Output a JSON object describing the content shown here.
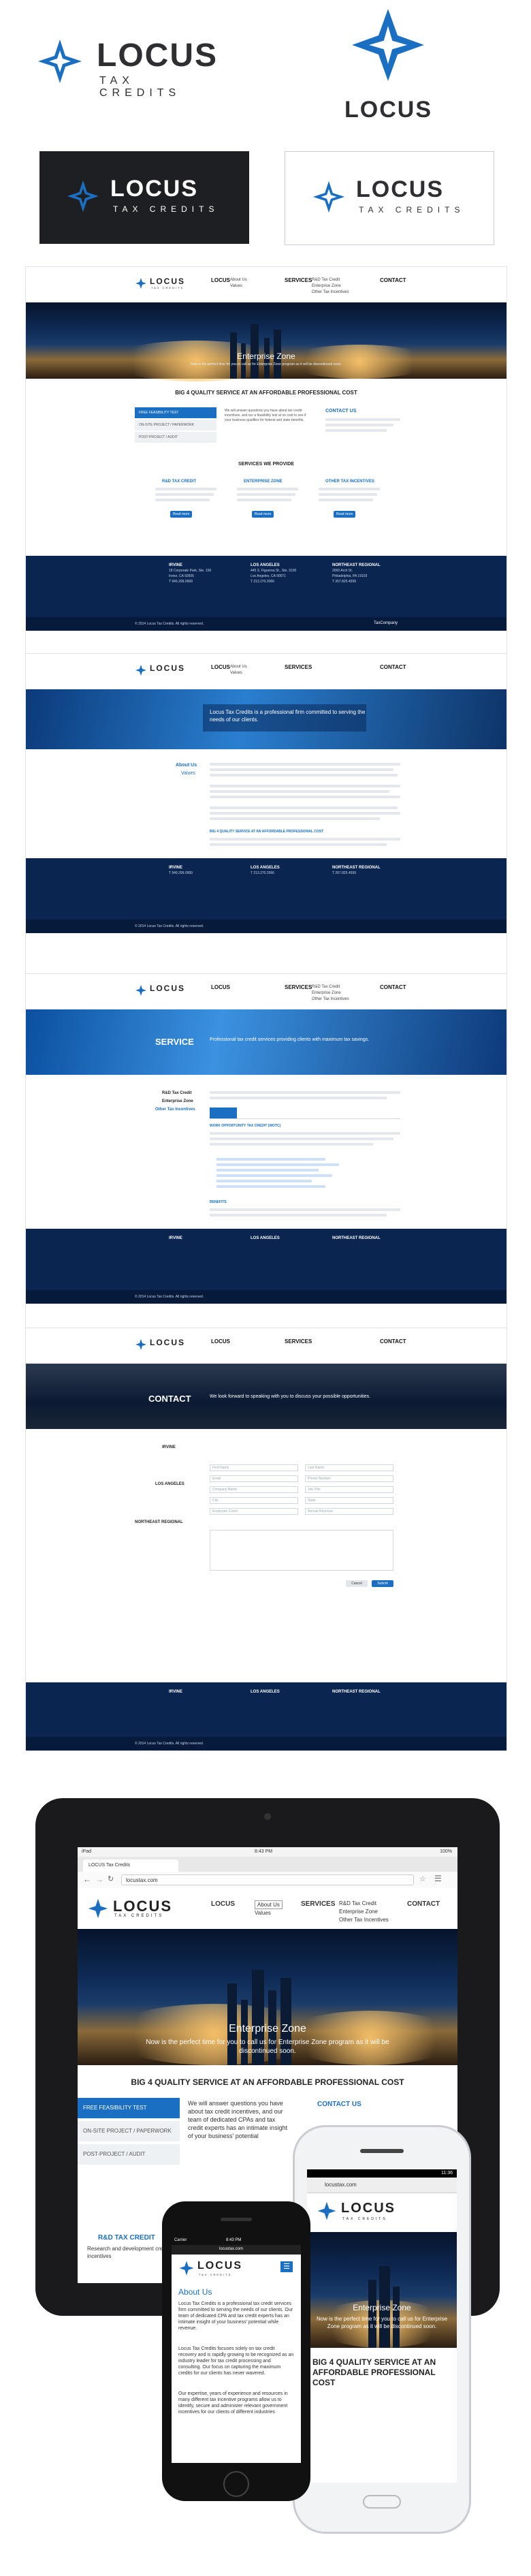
{
  "brand": {
    "name": "LOCUS",
    "tagline": "TAX CREDITS",
    "colors": {
      "primary_blue": "#1b6fc2",
      "navy": "#0b2a55",
      "dark_box": "#1e1f22"
    }
  },
  "nav": {
    "items": [
      "LOCUS",
      "About Us",
      "Values",
      "SERVICES",
      "R&D Tax Credit",
      "Enterprise Zone",
      "Other Tax Incentives",
      "CONTACT"
    ]
  },
  "home": {
    "hero_title": "Enterprise Zone",
    "hero_sub": "Now is the perfect time for you to call us for Enterprise Zone program as it will be discontinued soon.",
    "tagline": "BIG 4 QUALITY SERVICE AT AN AFFORDABLE PROFESSIONAL COST",
    "tabs": [
      "FREE FEASIBILITY TEST",
      "ON-SITE PROJECT / PAPERWORK",
      "POST-PROJECT / AUDIT"
    ],
    "answer_text": "We will answer questions you have about tax credit incentives, and run a feasibility test at no cost to see if your business qualifies for federal and state benefits.",
    "contact_us": "CONTACT US",
    "services_heading": "SERVICES WE PROVIDE",
    "services": [
      "R&D TAX CREDIT",
      "ENTERPRISE ZONE",
      "OTHER TAX INCENTIVES"
    ],
    "read_more": "Read more"
  },
  "footer": {
    "cols": [
      {
        "title": "IRVINE",
        "lines": [
          "18 Corporate Park, Ste. 150",
          "Irvine, CA 92606",
          "T 949.299.0999"
        ]
      },
      {
        "title": "LOS ANGELES",
        "lines": [
          "445 S. Figueroa St., Ste. 3100",
          "Los Angeles, CA 90071",
          "T 213.270.2066"
        ]
      },
      {
        "title": "NORTHEAST REGIONAL",
        "lines": [
          "2000 Arch St.",
          "Philadelphia, PA 19103",
          "T 267.825.4599"
        ]
      }
    ],
    "copyright": "© 2014 Locus Tax Credits. All rights reserved.",
    "partner": "TaxCompany"
  },
  "about": {
    "hero": "Locus Tax Credits is a professional firm committed to serving the needs of our clients.",
    "side": [
      "About Us",
      "Values"
    ],
    "heading": "BIG 4 QUALITY SERVICE AT AN AFFORDABLE PROFESSIONAL COST"
  },
  "service": {
    "hero_title": "SERVICE",
    "hero_sub": "Professional tax credit services providing clients with maximum tax savings.",
    "side": [
      "R&D Tax Credit",
      "Enterprise Zone",
      "Other Tax Incentives"
    ],
    "section_heading": "WORK OPPORTUNITY TAX CREDIT (WOTC)",
    "benefits": "BENEFITS"
  },
  "contact": {
    "hero_title": "CONTACT",
    "hero_sub": "We look forward to speaking with you to discuss your possible opportunities.",
    "form": [
      "First Name",
      "Last Name",
      "Email",
      "Phone Number",
      "Company Name",
      "Job Title",
      "City",
      "State",
      "Employee Count",
      "Annual Revenue"
    ],
    "cancel": "Cancel",
    "submit": "Submit"
  },
  "devices": {
    "tablet": {
      "status_left": "iPad",
      "time": "8:43 PM",
      "battery": "100%",
      "tab_title": "LOCUS Tax Credits",
      "url": "locustax.com",
      "nav_locus": "LOCUS",
      "nav_about": "About Us",
      "nav_values": "Values",
      "nav_services": "SERVICES",
      "nav_rd": "R&D Tax Credit",
      "nav_ez": "Enterprise Zone",
      "nav_other": "Other Tax Incentives",
      "nav_contact": "CONTACT",
      "hero_title": "Enterprise Zone",
      "hero_sub": "Now is the perfect time for you to call us for Enterprise Zone program as it will be discontinued soon.",
      "tagline": "BIG 4 QUALITY SERVICE AT AN AFFORDABLE PROFESSIONAL COST",
      "tabs": [
        "FREE FEASIBILITY TEST",
        "ON-SITE PROJECT / PAPERWORK",
        "POST-PROJECT / AUDIT"
      ],
      "answer": "We will answer questions you have about tax credit incentives, and our team of dedicated CPAs and tax credit experts has an intimate insight of your business' potential",
      "contact_us": "CONTACT US",
      "rd": "R&D TAX CREDIT",
      "rd_text": "Research and development credit incentives"
    },
    "phone": {
      "carrier": "Carrier",
      "time": "8:43 PM",
      "url": "locustax.com",
      "heading": "About Us",
      "p1": "Locus Tax Credits is a professional tax credit services firm committed to serving the needs of our clients. Our team of dedicated CPA and tax credit experts has an intimate insight of your business' potential while revenue.",
      "p2": "Locus Tax Credits focuses solely on tax credit recovery and is rapidly growing to be recognized as an industry leader for tax credit processing and consulting. Our focus on capturing the maximum credits for our clients has never wavered.",
      "p3": "Our expertise, years of experience and resources in many different tax incentive programs allow us to identify, secure and administer relevant government incentives for our clients of different industries"
    },
    "android": {
      "time": "11:36",
      "url": "locustax.com",
      "hero_title": "Enterprise Zone",
      "hero_sub": "Now is the perfect time for you to call us for Enterprise Zone program as it will be discontinued soon.",
      "tagline": "BIG 4 QUALITY SERVICE AT AN AFFORDABLE PROFESSIONAL COST"
    }
  }
}
